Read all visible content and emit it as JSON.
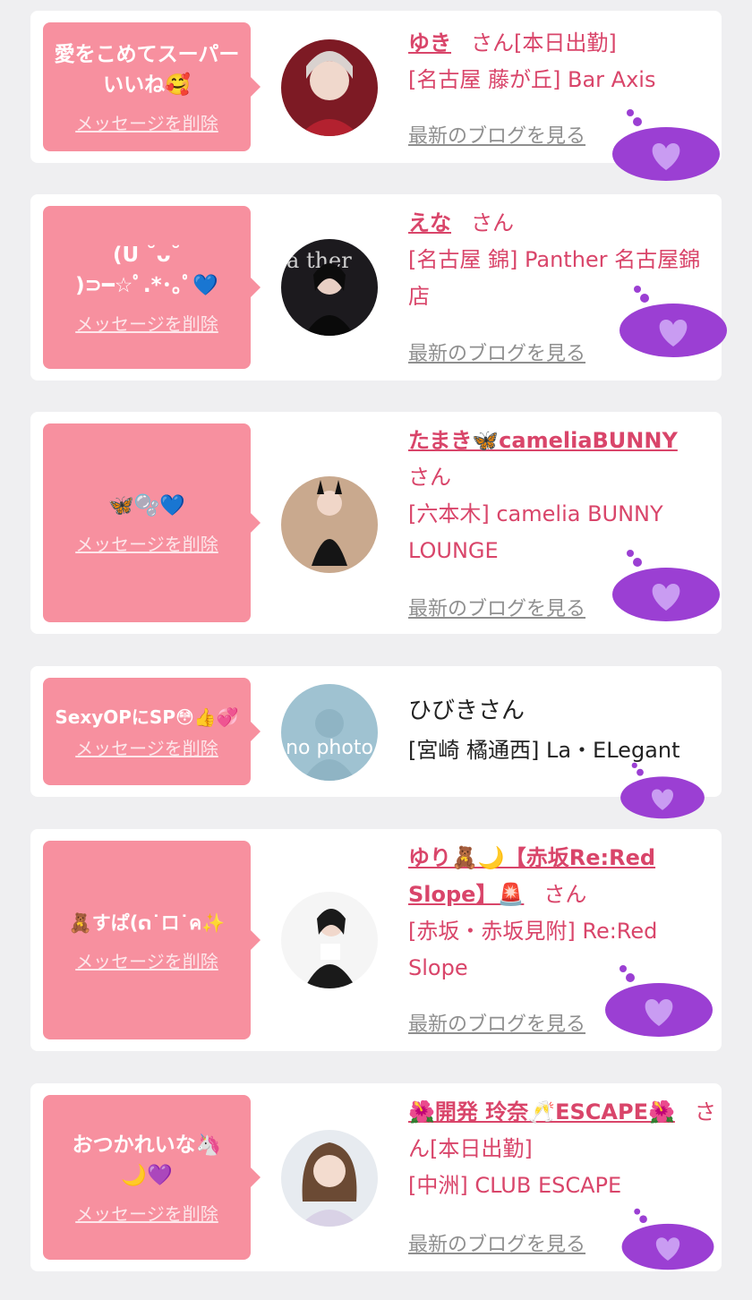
{
  "delete_label": "メッセージを削除",
  "blog_label": "最新のブログを見る",
  "san_suffix": "さん",
  "colors": {
    "page_bg": "#efeff1",
    "bubble": "#f7909f",
    "accent": "#d9456a",
    "heart": "#9b3fd3"
  },
  "items": [
    {
      "message": "愛をこめてスーパーいいね🥰",
      "name": "ゆき",
      "status": "[本日出勤]",
      "shop": "[名古屋 藤が丘] Bar Axis",
      "avatar_icon": "girl-avatar"
    },
    {
      "message": "(U ˘ᴗ˘ )⊃━☆ﾟ.*･｡ﾟ💙",
      "name": "えな",
      "status": "",
      "shop": "[名古屋 錦] Panther 名古屋錦店",
      "avatar_icon": "girl-avatar"
    },
    {
      "message": "🦋🫧💙",
      "name": "たまき🦋cameliaBUNNY",
      "status": "",
      "shop": "[六本木] camelia BUNNY LOUNGE",
      "avatar_icon": "girl-avatar"
    },
    {
      "message": "SexyOPにSP😳👍💞",
      "name": "ひびき",
      "status": "",
      "shop": "[宮崎 橘通西] La・ELegant",
      "avatar_icon": "no-photo"
    },
    {
      "message": "🧸すぱ(ດ˙ロ˙ค✨",
      "name": "ゆり🧸🌙【赤坂Re:Red Slope】🚨",
      "status": "",
      "shop": "[赤坂・赤坂見附] Re:Red Slope",
      "avatar_icon": "girl-avatar"
    },
    {
      "message": "おつかれいな🦄🌙💜",
      "name": "🌺開発 玲奈🥂ESCAPE🌺",
      "status": "[本日出勤]",
      "shop": "[中洲] CLUB ESCAPE",
      "avatar_icon": "girl-avatar"
    }
  ]
}
